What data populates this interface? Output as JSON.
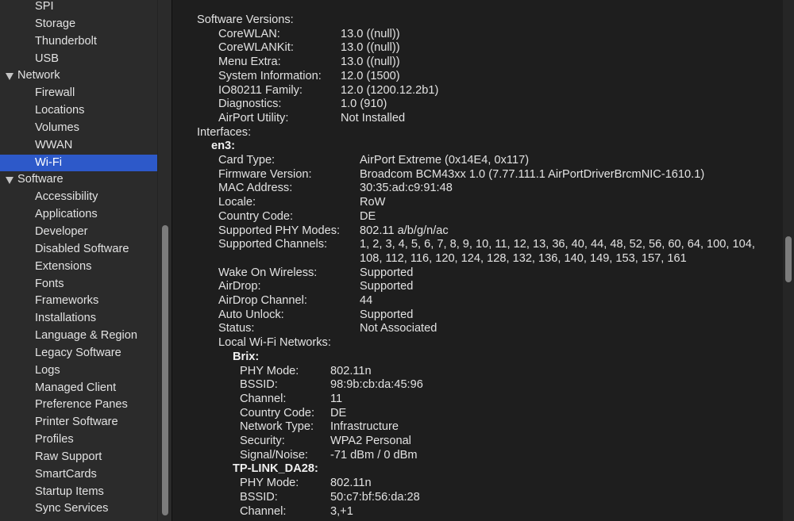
{
  "sidebar": {
    "items": [
      {
        "label": "SPI",
        "level": 1
      },
      {
        "label": "Storage",
        "level": 1
      },
      {
        "label": "Thunderbolt",
        "level": 1
      },
      {
        "label": "USB",
        "level": 1
      },
      {
        "label": "Network",
        "level": 0,
        "expanded": true
      },
      {
        "label": "Firewall",
        "level": 1
      },
      {
        "label": "Locations",
        "level": 1
      },
      {
        "label": "Volumes",
        "level": 1
      },
      {
        "label": "WWAN",
        "level": 1
      },
      {
        "label": "Wi-Fi",
        "level": 1,
        "selected": true
      },
      {
        "label": "Software",
        "level": 0,
        "expanded": true
      },
      {
        "label": "Accessibility",
        "level": 1
      },
      {
        "label": "Applications",
        "level": 1
      },
      {
        "label": "Developer",
        "level": 1
      },
      {
        "label": "Disabled Software",
        "level": 1
      },
      {
        "label": "Extensions",
        "level": 1
      },
      {
        "label": "Fonts",
        "level": 1
      },
      {
        "label": "Frameworks",
        "level": 1
      },
      {
        "label": "Installations",
        "level": 1
      },
      {
        "label": "Language & Region",
        "level": 1
      },
      {
        "label": "Legacy Software",
        "level": 1
      },
      {
        "label": "Logs",
        "level": 1
      },
      {
        "label": "Managed Client",
        "level": 1
      },
      {
        "label": "Preference Panes",
        "level": 1
      },
      {
        "label": "Printer Software",
        "level": 1
      },
      {
        "label": "Profiles",
        "level": 1
      },
      {
        "label": "Raw Support",
        "level": 1
      },
      {
        "label": "SmartCards",
        "level": 1
      },
      {
        "label": "Startup Items",
        "level": 1
      },
      {
        "label": "Sync Services",
        "level": 1
      }
    ]
  },
  "content": {
    "software_versions": {
      "heading": "Software Versions:",
      "rows": [
        {
          "label": "CoreWLAN:",
          "value": "13.0 ((null))"
        },
        {
          "label": "CoreWLANKit:",
          "value": "13.0 ((null))"
        },
        {
          "label": "Menu Extra:",
          "value": "13.0 ((null))"
        },
        {
          "label": "System Information:",
          "value": "12.0 (1500)"
        },
        {
          "label": "IO80211 Family:",
          "value": "12.0 (1200.12.2b1)"
        },
        {
          "label": "Diagnostics:",
          "value": "1.0 (910)"
        },
        {
          "label": "AirPort Utility:",
          "value": "Not Installed"
        }
      ]
    },
    "interfaces": {
      "heading": "Interfaces:",
      "name": "en3:",
      "rows": [
        {
          "label": "Card Type:",
          "value": "AirPort Extreme  (0x14E4, 0x117)"
        },
        {
          "label": "Firmware Version:",
          "value": "Broadcom BCM43xx 1.0 (7.77.111.1 AirPortDriverBrcmNIC-1610.1)"
        },
        {
          "label": "MAC Address:",
          "value": "30:35:ad:c9:91:48"
        },
        {
          "label": "Locale:",
          "value": "RoW"
        },
        {
          "label": "Country Code:",
          "value": "DE"
        },
        {
          "label": "Supported PHY Modes:",
          "value": "802.11 a/b/g/n/ac"
        },
        {
          "label": "Supported Channels:",
          "value": "1, 2, 3, 4, 5, 6, 7, 8, 9, 10, 11, 12, 13, 36, 40, 44, 48, 52, 56, 60, 64, 100, 104,",
          "value2": "108, 112, 116, 120, 124, 128, 132, 136, 140, 149, 153, 157, 161"
        },
        {
          "label": "Wake On Wireless:",
          "value": "Supported"
        },
        {
          "label": "AirDrop:",
          "value": "Supported"
        },
        {
          "label": "AirDrop Channel:",
          "value": "44"
        },
        {
          "label": "Auto Unlock:",
          "value": "Supported"
        },
        {
          "label": "Status:",
          "value": "Not Associated"
        }
      ],
      "local_networks_heading": "Local Wi-Fi Networks:",
      "networks": [
        {
          "name": "Brix:",
          "rows": [
            {
              "label": "PHY Mode:",
              "value": "802.11n"
            },
            {
              "label": "BSSID:",
              "value": "98:9b:cb:da:45:96"
            },
            {
              "label": "Channel:",
              "value": "11"
            },
            {
              "label": "Country Code:",
              "value": "DE"
            },
            {
              "label": "Network Type:",
              "value": "Infrastructure"
            },
            {
              "label": "Security:",
              "value": "WPA2 Personal"
            },
            {
              "label": "Signal/Noise:",
              "value": "-71 dBm / 0 dBm"
            }
          ]
        },
        {
          "name": "TP-LINK_DA28:",
          "rows": [
            {
              "label": "PHY Mode:",
              "value": "802.11n"
            },
            {
              "label": "BSSID:",
              "value": "50:c7:bf:56:da:28"
            },
            {
              "label": "Channel:",
              "value": "3,+1"
            }
          ]
        }
      ]
    }
  }
}
